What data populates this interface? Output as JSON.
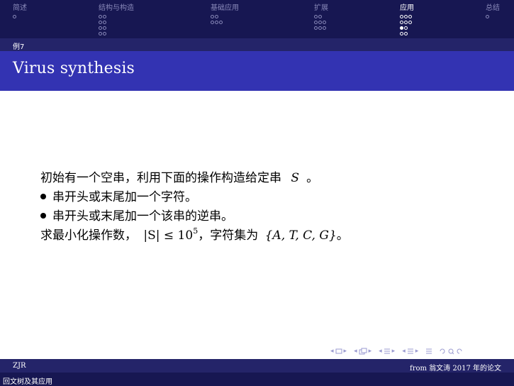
{
  "nav": {
    "sections": [
      {
        "label": "简述",
        "dots": [
          [
            0
          ]
        ]
      },
      {
        "label": "结构与构造",
        "dots": [
          [
            0,
            0
          ],
          [
            0,
            0
          ],
          [
            0,
            0
          ],
          [
            0,
            0
          ]
        ]
      },
      {
        "label": "基础应用",
        "dots": [
          [
            0,
            0
          ],
          [
            0,
            0,
            0
          ]
        ]
      },
      {
        "label": "扩展",
        "dots": [
          [
            0,
            0
          ],
          [
            0,
            0,
            0
          ],
          [
            0,
            0,
            0
          ]
        ]
      },
      {
        "label": "应用",
        "dots": [
          [
            0,
            0,
            0
          ],
          [
            0,
            0,
            0
          ],
          [
            1,
            0
          ],
          [
            0,
            0
          ]
        ]
      },
      {
        "label": "总结",
        "dots": [
          [
            0
          ]
        ]
      }
    ],
    "subsection": "例7"
  },
  "frame": {
    "title": "Virus synthesis"
  },
  "body": {
    "line1_text": "初始有一个空串，利用下面的操作构造给定串",
    "line1_var": "S",
    "line1_end": "。",
    "bullet1": "串开头或末尾加一个字符。",
    "bullet2": "串开头或末尾加一个该串的逆串。",
    "line4_text": "求最小化操作数，",
    "line4_math": "|S| ≤ 10",
    "line4_exp": "5",
    "line4_mid": "，字符集为",
    "line4_set": "{A, T, C, G}",
    "line4_end": "。"
  },
  "footer": {
    "author": "ZJR",
    "source": "from 翁文涛 2017 年的论文",
    "short_title": "回文树及其应用"
  },
  "colors": {
    "nav_bg": "#171752",
    "subbar_bg": "#242469",
    "title_bg": "#3333b2",
    "nav_inactive": "#8888b8",
    "navsym": "#9a9ad0"
  }
}
